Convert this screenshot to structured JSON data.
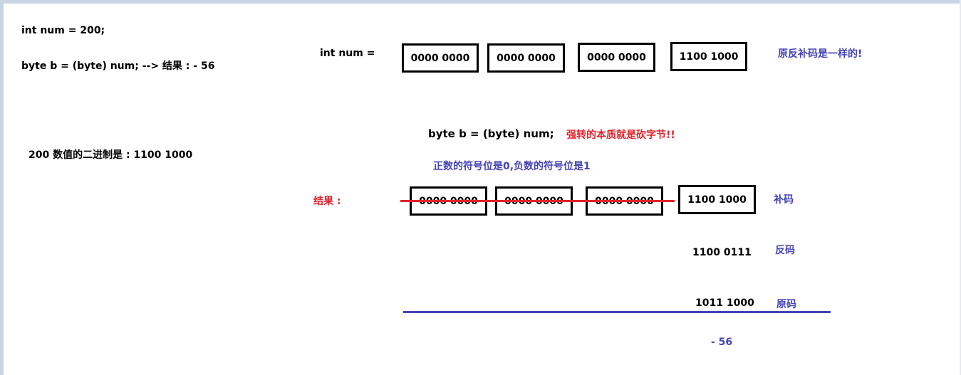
{
  "left": {
    "line1": "int num = 200;",
    "line2": "byte b = (byte) num;  --> 结果 : - 56",
    "line3": "200 数值的二进制是 : 1100 1000"
  },
  "int_row": {
    "label": "int num =",
    "bytes": [
      "0000 0000",
      "0000 0000",
      "0000 0000",
      "1100 1000"
    ],
    "note": "原反补码是一样的!"
  },
  "byte_section": {
    "cast_line": "byte b = (byte) num;",
    "cast_note": "强转的本质就是砍字节!!",
    "sign_note": "正数的符号位是0,负数的符号位是1",
    "result_label": "结果 :",
    "bytes": [
      "0000 0000",
      "0000 0000",
      "0000 0000",
      "1100 1000"
    ],
    "complement_label": "补码",
    "ones_value": "1100 0111",
    "ones_label": "反码",
    "original_value": "1011 1000",
    "original_label": "原码",
    "final_value": "- 56"
  },
  "colors": {
    "blue": "#4545b5",
    "red": "#e0242c",
    "frame": "#c8d3e3"
  }
}
